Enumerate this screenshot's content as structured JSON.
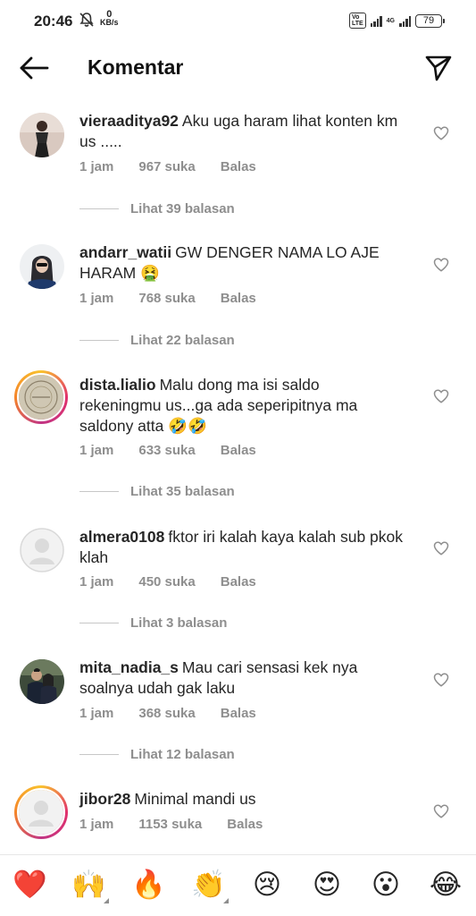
{
  "status_bar": {
    "time": "20:46",
    "speed_value": "0",
    "speed_unit": "KB/s",
    "volte": "Vo LTE",
    "network": "4G",
    "battery": "79"
  },
  "header": {
    "title": "Komentar",
    "back_icon": "arrow-left-icon",
    "send_icon": "send-icon"
  },
  "comments": [
    {
      "username": "vieraaditya92",
      "text": "Aku uga haram lihat konten km us .....",
      "time": "1 jam",
      "likes": "967 suka",
      "reply": "Balas",
      "view_replies": "Lihat 39 balasan",
      "avatar_type": "photo-person",
      "story_ring": false
    },
    {
      "username": "andarr_watii",
      "text": "GW DENGER NAMA LO AJE HARAM 🤮",
      "time": "1 jam",
      "likes": "768 suka",
      "reply": "Balas",
      "view_replies": "Lihat 22 balasan",
      "avatar_type": "photo-hijab",
      "story_ring": false
    },
    {
      "username": "dista.lialio",
      "text": "Malu dong ma isi saldo rekeningmu us...ga ada seperipitnya ma saldony atta 🤣🤣",
      "time": "1 jam",
      "likes": "633 suka",
      "reply": "Balas",
      "view_replies": "Lihat 35 balasan",
      "avatar_type": "photo-logo",
      "story_ring": true
    },
    {
      "username": "almera0108",
      "text": "fktor iri kalah kaya kalah sub pkok klah",
      "time": "1 jam",
      "likes": "450 suka",
      "reply": "Balas",
      "view_replies": "Lihat 3 balasan",
      "avatar_type": "default",
      "story_ring": false
    },
    {
      "username": "mita_nadia_s",
      "text": "Mau cari sensasi kek nya soalnya udah gak laku",
      "time": "1 jam",
      "likes": "368 suka",
      "reply": "Balas",
      "view_replies": "Lihat 12 balasan",
      "avatar_type": "photo-couple",
      "story_ring": false
    },
    {
      "username": "jibor28",
      "text": "Minimal mandi us",
      "time": "1 jam",
      "likes": "1153 suka",
      "reply": "Balas",
      "view_replies": "",
      "avatar_type": "default",
      "story_ring": true
    }
  ],
  "emoji_bar": [
    {
      "emoji": "❤️",
      "name": "red-heart"
    },
    {
      "emoji": "🙌",
      "name": "raising-hands"
    },
    {
      "emoji": "🔥",
      "name": "fire"
    },
    {
      "emoji": "👏",
      "name": "clapping-hands"
    },
    {
      "emoji": "😢",
      "name": "crying-face"
    },
    {
      "emoji": "😍",
      "name": "heart-eyes"
    },
    {
      "emoji": "😮",
      "name": "open-mouth"
    },
    {
      "emoji": "😂",
      "name": "tears-of-joy"
    }
  ],
  "colors": {
    "text": "#262626",
    "secondary_text": "#8e8e8e",
    "background": "#ffffff"
  }
}
